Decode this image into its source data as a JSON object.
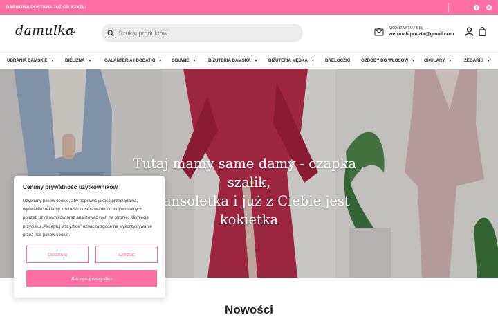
{
  "topbar": {
    "promo": "DARMOWA DOSTAWA JUŻ OD XXXZŁ!",
    "social": [
      "facebook-icon",
      "instagram-icon"
    ]
  },
  "header": {
    "logo": "damulka",
    "search_placeholder": "Szukaj produktów",
    "contact_label": "SKONTAKTUJ SIĘ",
    "contact_email": "weronati.poczta@gmail.com",
    "icons": [
      "mail-icon",
      "user-icon",
      "bag-icon"
    ]
  },
  "nav": {
    "items": [
      {
        "label": "UBRANIA DAMSKIE",
        "dropdown": true
      },
      {
        "label": "BIELIZNA",
        "dropdown": true
      },
      {
        "label": "GALANTERIA I DODATKI",
        "dropdown": true
      },
      {
        "label": "OBUWIE",
        "dropdown": true
      },
      {
        "label": "BIŻUTERIA DAMSKA",
        "dropdown": true
      },
      {
        "label": "BIŻUTERIA MĘSKA",
        "dropdown": true
      },
      {
        "label": "BRELOCZKI",
        "dropdown": false
      },
      {
        "label": "OZDOBY DO WŁOSÓW",
        "dropdown": true
      },
      {
        "label": "OKULARY",
        "dropdown": true
      },
      {
        "label": "ZEGARKI",
        "dropdown": true
      }
    ]
  },
  "hero": {
    "line1": "Tutaj mamy same damy - czapka , szalik,",
    "line2": "bransoletka i już z Ciebie jest kokietka"
  },
  "section": {
    "title": "Nowości"
  },
  "cookie": {
    "title": "Cenimy prywatność użytkowników",
    "text": "Używamy plików cookie, aby poprawić jakość przeglądania, wyświetlać reklamy lub treści dostosowane do indywidualnych potrzeb użytkowników oraz analizować ruch na stronie. Kliknięcie przycisku „Akceptuj wszystkie” oznacza zgodę na wykorzystywanie przez nas plików cookie.",
    "customize": "Dostosuj",
    "reject": "Odrzuć",
    "accept": "Akceptuj wszystko"
  },
  "colors": {
    "accent": "#ff6fa3"
  }
}
